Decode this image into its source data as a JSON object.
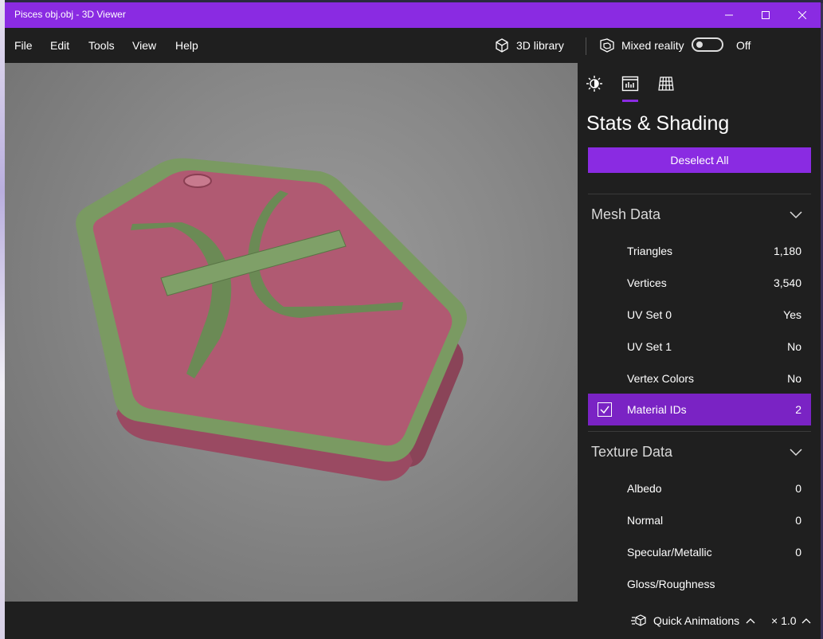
{
  "window": {
    "title": "Pisces obj.obj - 3D Viewer"
  },
  "menu": {
    "file": "File",
    "edit": "Edit",
    "tools": "Tools",
    "view": "View",
    "help": "Help"
  },
  "toolbar": {
    "library_label": "3D library",
    "mixed_reality_label": "Mixed reality",
    "mixed_reality_state": "Off"
  },
  "panel": {
    "title": "Stats & Shading",
    "deselect_label": "Deselect All",
    "tabs": [
      "lighting-icon",
      "stats-icon",
      "grid-icon"
    ],
    "active_tab": 1,
    "mesh": {
      "header": "Mesh Data",
      "rows": [
        {
          "label": "Triangles",
          "value": "1,180"
        },
        {
          "label": "Vertices",
          "value": "3,540"
        },
        {
          "label": "UV Set 0",
          "value": "Yes"
        },
        {
          "label": "UV Set 1",
          "value": "No"
        },
        {
          "label": "Vertex Colors",
          "value": "No"
        },
        {
          "label": "Material IDs",
          "value": "2",
          "selected": true,
          "checked": true
        }
      ]
    },
    "texture": {
      "header": "Texture Data",
      "rows": [
        {
          "label": "Albedo",
          "value": "0"
        },
        {
          "label": "Normal",
          "value": "0"
        },
        {
          "label": "Specular/Metallic",
          "value": "0"
        },
        {
          "label": "Gloss/Roughness",
          "value": ""
        }
      ]
    }
  },
  "status": {
    "quick_animations": "Quick Animations",
    "speed": "× 1.0"
  },
  "colors": {
    "accent": "#8a2be2",
    "selected_row": "#7a23c4",
    "model_green": "#7a9a62",
    "model_pink": "#b05a72"
  }
}
